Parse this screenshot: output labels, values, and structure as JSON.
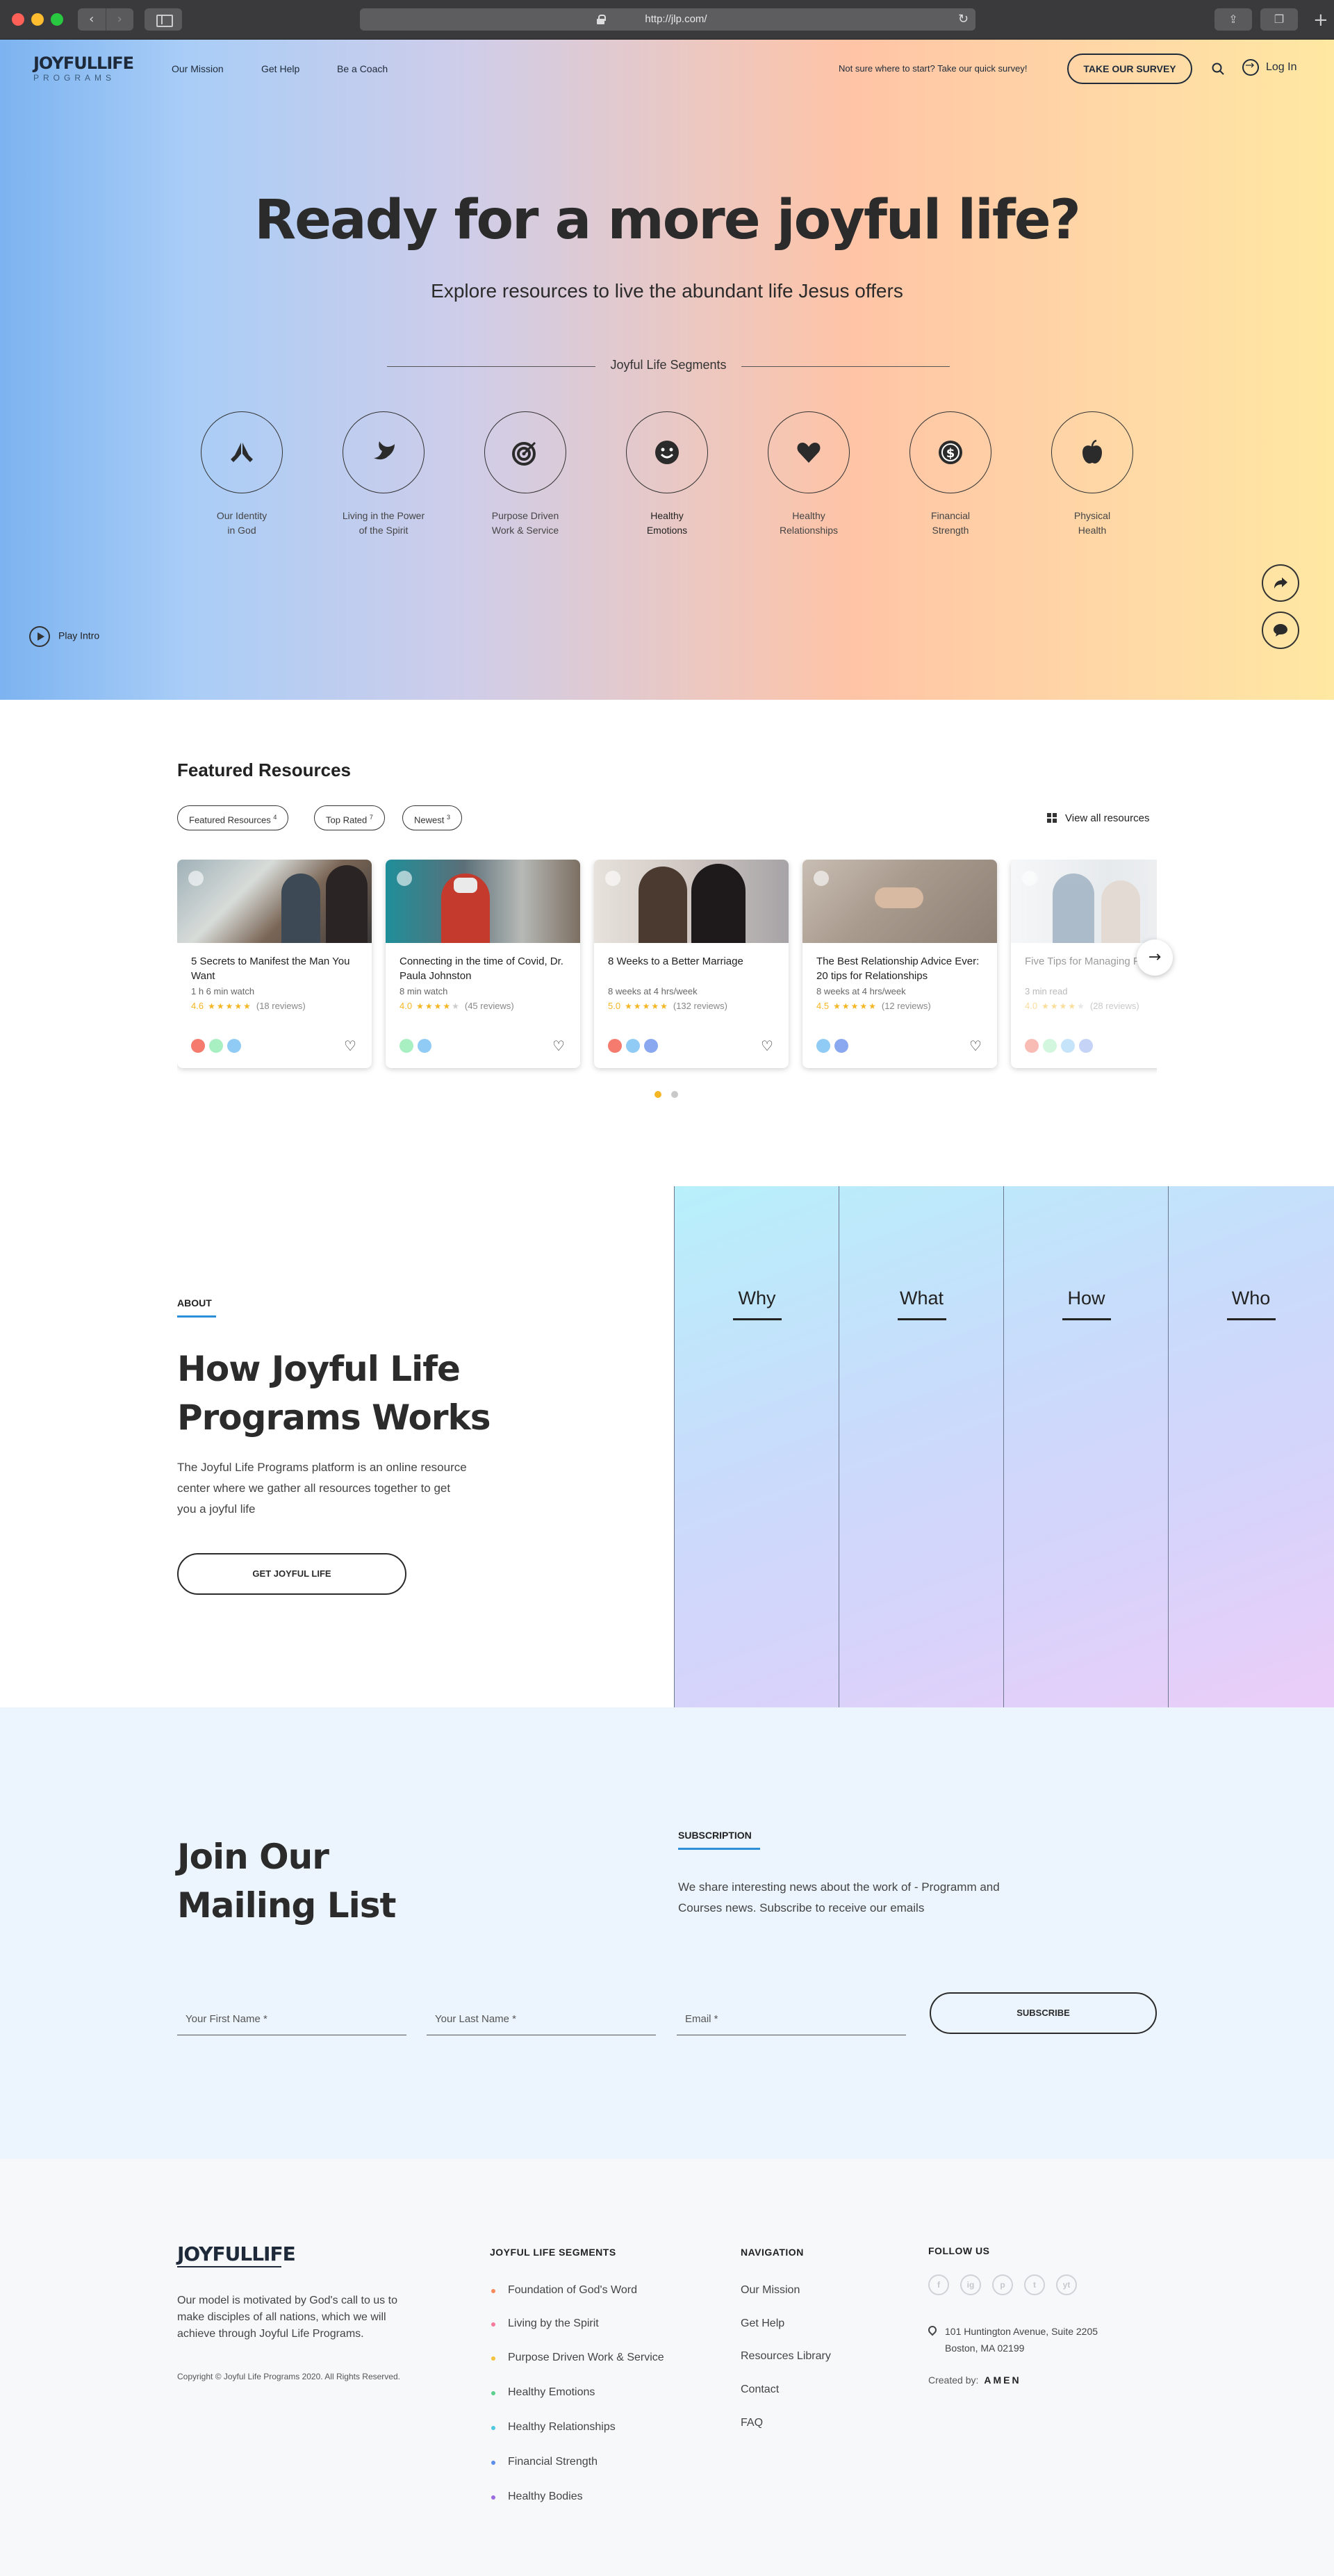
{
  "browser": {
    "url": "http://jlp.com/"
  },
  "header": {
    "logo_main": "JOYFULLIFE",
    "logo_sub": "PROGRAMS",
    "nav": [
      "Our Mission",
      "Get Help",
      "Be a Coach"
    ],
    "survey_hint": "Not sure where to start? Take our quick survey!",
    "survey_button": "TAKE OUR SURVEY",
    "login": "Log In"
  },
  "hero": {
    "title": "Ready for a more joyful life?",
    "subtitle": "Explore resources to live the abundant life Jesus offers",
    "segments_label": "Joyful Life Segments",
    "segments": [
      {
        "line1": "Our Identity",
        "line2": "in God",
        "icon": "praying-hands-icon"
      },
      {
        "line1": "Living in the Power",
        "line2": "of the Spirit",
        "icon": "dove-icon"
      },
      {
        "line1": "Purpose Driven",
        "line2": "Work & Service",
        "icon": "target-icon"
      },
      {
        "line1": "Healthy",
        "line2": "Emotions",
        "icon": "smiley-icon"
      },
      {
        "line1": "Healthy",
        "line2": "Relationships",
        "icon": "heart-icon"
      },
      {
        "line1": "Financial",
        "line2": "Strength",
        "icon": "dollar-coin-icon"
      },
      {
        "line1": "Physical",
        "line2": "Health",
        "icon": "apple-icon"
      }
    ],
    "play_intro": "Play Intro"
  },
  "featured": {
    "title": "Featured Resources",
    "tabs": [
      {
        "label": "Featured Resources",
        "count": "4"
      },
      {
        "label": "Top Rated",
        "count": "7"
      },
      {
        "label": "Newest",
        "count": "3"
      }
    ],
    "view_all": "View all resources",
    "cards": [
      {
        "title": "5 Secrets to Manifest the Man You Want",
        "meta": "1 h 6 min watch",
        "rating": "4.6",
        "stars": 5,
        "reviews": "(18 reviews)",
        "dots": [
          "#f47b6e",
          "#a8efc1",
          "#8fcbf5"
        ]
      },
      {
        "title": "Connecting in the time of Covid, Dr. Paula Johnston",
        "meta": "8 min watch",
        "rating": "4.0",
        "stars": 4,
        "reviews": "(45 reviews)",
        "dots": [
          "#a8efc1",
          "#8fcbf5"
        ]
      },
      {
        "title": "8 Weeks to a Better Marriage",
        "meta": "8 weeks at 4 hrs/week",
        "rating": "5.0",
        "stars": 5,
        "reviews": "(132 reviews)",
        "dots": [
          "#f47b6e",
          "#8fcbf5",
          "#8aa8ef"
        ]
      },
      {
        "title": "The Best Relationship Advice Ever:  20 tips for Relationships",
        "meta": "8 weeks at 4 hrs/week",
        "rating": "4.5",
        "stars": 5,
        "reviews": "(12 reviews)",
        "dots": [
          "#8fcbf5",
          "#8aa8ef"
        ]
      },
      {
        "title": "Five Tips for Managing Finances",
        "meta": "3 min read",
        "rating": "4.0",
        "stars": 4,
        "reviews": "(28 reviews)",
        "dots": [
          "#f47b6e",
          "#a8efc1",
          "#8fcbf5",
          "#8aa8ef"
        ]
      }
    ]
  },
  "about": {
    "kicker": "ABOUT",
    "title": "How Joyful Life Programs Works",
    "text": "The Joyful Life Programs platform is an online resource center where we gather all resources together to get you a joyful life",
    "button": "GET JOYFUL LIFE",
    "panels": [
      "Why",
      "What",
      "How",
      "Who"
    ]
  },
  "mailing": {
    "title_line1": "Join Our",
    "title_line2": "Mailing List",
    "kicker": "SUBSCRIPTION",
    "text": "We share interesting news about the work of - Programm and Courses news. Subscribe to receive our emails",
    "first_name_placeholder": "Your First Name *",
    "last_name_placeholder": "Your Last Name *",
    "email_placeholder": "Email *",
    "subscribe": "SUBSCRIBE"
  },
  "footer": {
    "logo": "JOYFULLIFE",
    "about": "Our model is motivated by God's call to us to make disciples of all nations, which we will achieve through Joyful Life Programs.",
    "copyright": "Copyright © Joyful Life Programs 2020. All Rights Reserved.",
    "segments_heading": "JOYFUL LIFE SEGMENTS",
    "segments": [
      {
        "label": "Foundation of God's Word",
        "color": "#f58a5b"
      },
      {
        "label": "Living by the Spirit",
        "color": "#f47b9b"
      },
      {
        "label": "Purpose Driven Work & Service",
        "color": "#f5c23b"
      },
      {
        "label": "Healthy Emotions",
        "color": "#5ccf8e"
      },
      {
        "label": "Healthy Relationships",
        "color": "#4fc9e0"
      },
      {
        "label": "Financial Strength",
        "color": "#5b8ee8"
      },
      {
        "label": "Healthy Bodies",
        "color": "#9b6be0"
      }
    ],
    "nav_heading": "NAVIGATION",
    "nav": [
      "Our Mission",
      "Get Help",
      "Resources Library",
      "Contact",
      "FAQ"
    ],
    "follow_heading": "FOLLOW US",
    "social": [
      "f",
      "ig",
      "p",
      "t",
      "yt"
    ],
    "address_line1": "101 Huntington Avenue, Suite 2205",
    "address_line2": "Boston, MA 02199",
    "created_by": "Created by:",
    "created_by_brand": "AMEN"
  }
}
